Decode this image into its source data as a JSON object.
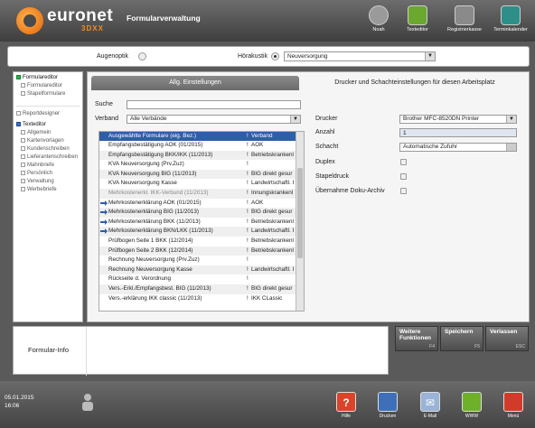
{
  "header": {
    "logo_text": "euronet",
    "logo_sub": "3DXX",
    "title": "Formularverwaltung",
    "buttons": [
      {
        "label": "Noah",
        "icon": "noah-icon",
        "color": "#9a9a9a"
      },
      {
        "label": "Texteditor",
        "icon": "pencil-icon",
        "color": "#6aa82f"
      },
      {
        "label": "Registrierkasse",
        "icon": "cash-register-icon",
        "color": "#8a8a8a"
      },
      {
        "label": "Terminkalender",
        "icon": "calendar-icon",
        "color": "#2e8f8a"
      }
    ]
  },
  "filter": {
    "augenoptik_label": "Augenoptik",
    "hoerakustik_label": "Hörakustik",
    "selected": "Hörakustik",
    "dropdown_value": "Neuversorgung"
  },
  "nav": {
    "sections": [
      {
        "label": "Formulareditor",
        "items": [
          "Formulareditor",
          "Stapelformulare"
        ]
      },
      {
        "label": "Reportdesigner"
      },
      {
        "label": "Texteditor",
        "items": [
          "Allgemein",
          "Kartenvorlagen",
          "Kundenschreiben",
          "Lieferantenschreiben",
          "Mahnbriefe",
          "Persönlich",
          "Verwaltung",
          "Werbebriefe"
        ]
      }
    ]
  },
  "tabs": {
    "active": "Allg. Einstellungen",
    "inactive": "Drucker und Schachteinstellungen für diesen Arbeitsplatz"
  },
  "search": {
    "label": "Suche",
    "value": ""
  },
  "verband": {
    "label": "Verband",
    "value": "Alle Verbände"
  },
  "list": {
    "header": {
      "name": "Ausgewählte Formulare (eig. Bez.)",
      "flag": "!",
      "verband": "Verband"
    },
    "rows": [
      {
        "name": "Empfangsbestätigung AOK (01/2015)",
        "flag": "!",
        "verband": "AOK",
        "arrow": false,
        "gray": false
      },
      {
        "name": "Empfangsbestätigung BKK/IKK (11/2013)",
        "flag": "!",
        "verband": "Betriebskrankenl",
        "arrow": false,
        "gray": false
      },
      {
        "name": "KVA Neuversorgung (Prv.Zuz)",
        "flag": "!",
        "verband": "",
        "arrow": false,
        "gray": false
      },
      {
        "name": "KVA Neuversorgung BIG (11/2013)",
        "flag": "!",
        "verband": "BIG direkt gesur",
        "arrow": false,
        "gray": false
      },
      {
        "name": "KVA Neuversorgung Kasse",
        "flag": "!",
        "verband": "Landwirtschaftl. I",
        "arrow": false,
        "gray": false
      },
      {
        "name": "Mehrkostenerkl. IKK-Verbund (11/2013)",
        "flag": "!",
        "verband": "Innungskrankenl",
        "arrow": false,
        "gray": true
      },
      {
        "name": "Mehrkostenerklärung AOK (01/2015)",
        "flag": "!",
        "verband": "AOK",
        "arrow": true,
        "gray": false
      },
      {
        "name": "Mehrkostenerklärung BIG (11/2013)",
        "flag": "!",
        "verband": "BIG direkt gesur",
        "arrow": true,
        "gray": false
      },
      {
        "name": "Mehrkostenerklärung BKK (11/2013)",
        "flag": "!",
        "verband": "Betriebskrankenl",
        "arrow": true,
        "gray": false
      },
      {
        "name": "Mehrkostenerklärung BKN/LKK (11/2013)",
        "flag": "!",
        "verband": "Landwirtschaftl. I",
        "arrow": true,
        "gray": false
      },
      {
        "name": "Prüfbogen Seite 1 BKK (12/2014)",
        "flag": "!",
        "verband": "Betriebskrankenl",
        "arrow": false,
        "gray": false
      },
      {
        "name": "Prüfbogen Seite 2 BKK (12/2014)",
        "flag": "!",
        "verband": "Betriebskrankenl",
        "arrow": false,
        "gray": false
      },
      {
        "name": "Rechnung Neuversorgung (Prv.Zuz)",
        "flag": "!",
        "verband": "",
        "arrow": false,
        "gray": false
      },
      {
        "name": "Rechnung Neuversorgung Kasse",
        "flag": "!",
        "verband": "Landwirtschaftl. I",
        "arrow": false,
        "gray": false
      },
      {
        "name": "Rückseite d. Verordnung",
        "flag": "!",
        "verband": "",
        "arrow": false,
        "gray": false
      },
      {
        "name": "Vers.-Erkl./Empfangsbest. BIG (11/2013)",
        "flag": "!",
        "verband": "BIG direkt gesur",
        "arrow": false,
        "gray": false
      },
      {
        "name": "Vers.-erklärung IKK classic (11/2013)",
        "flag": "!",
        "verband": "IKK CLassic",
        "arrow": false,
        "gray": false
      }
    ]
  },
  "printer": {
    "drucker_label": "Drucker",
    "drucker_value": "Brother MFC-8520DN Printer",
    "anzahl_label": "Anzahl",
    "anzahl_value": "1",
    "schacht_label": "Schacht",
    "schacht_value": "Automatische Zufuhr",
    "duplex_label": "Duplex",
    "stapeldruck_label": "Stapeldruck",
    "doku_label": "Übernahme Doku-Archiv"
  },
  "info": {
    "label": "Formular-Info"
  },
  "fkeys": [
    {
      "label": "Weitere Funktionen",
      "key": "F4"
    },
    {
      "label": "Speichern",
      "key": "F5"
    },
    {
      "label": "Verlassen",
      "key": "ESC"
    }
  ],
  "footer": {
    "date": "05.01.2015",
    "time": "16:06",
    "buttons": [
      {
        "label": "Hilfe",
        "icon": "help-icon",
        "color": "#d9442a"
      },
      {
        "label": "Drucken",
        "icon": "printer-icon",
        "color": "#3e6fb8"
      },
      {
        "label": "E-Mail",
        "icon": "email-icon",
        "color": "#9ab3d6"
      },
      {
        "label": "WWW",
        "icon": "globe-icon",
        "color": "#6fb02a"
      },
      {
        "label": "Menü",
        "icon": "menu-grid-icon",
        "color": "#d23a2a"
      }
    ]
  }
}
